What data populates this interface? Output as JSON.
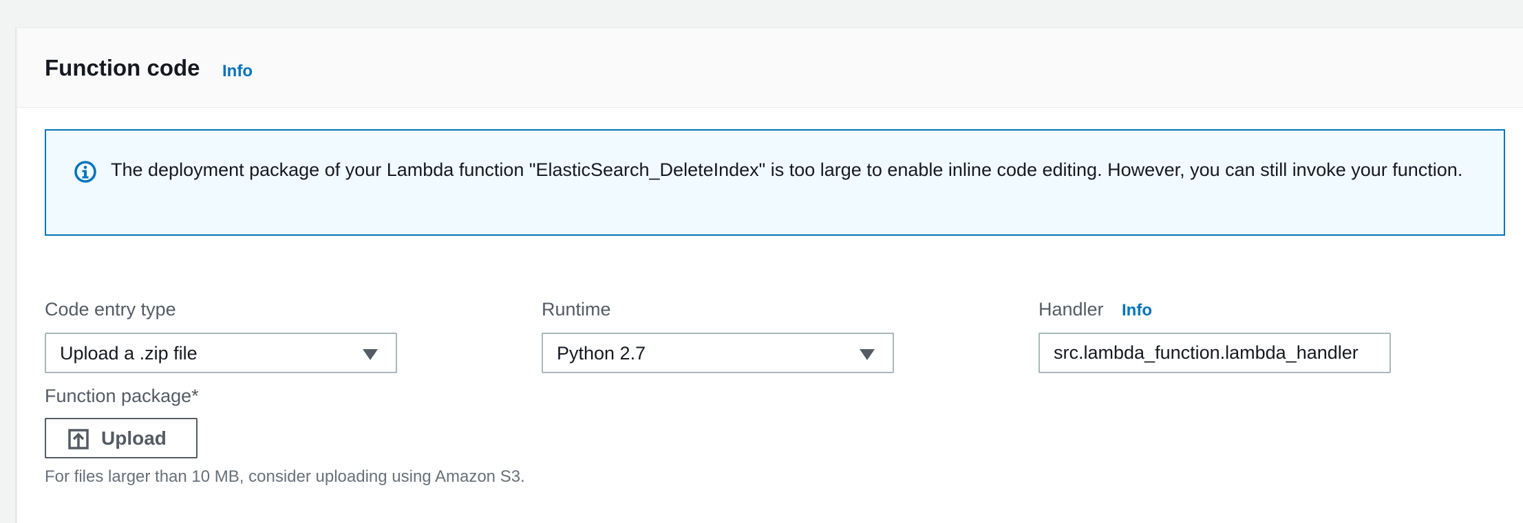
{
  "section": {
    "title": "Function code",
    "info_link": "Info"
  },
  "alert": {
    "icon": "info-circle-icon",
    "message": "The deployment package of your Lambda function \"ElasticSearch_DeleteIndex\" is too large to enable inline code editing. However, you can still invoke your function."
  },
  "fields": {
    "code_entry_type": {
      "label": "Code entry type",
      "value": "Upload a .zip file"
    },
    "runtime": {
      "label": "Runtime",
      "value": "Python 2.7"
    },
    "handler": {
      "label": "Handler",
      "info_link": "Info",
      "value": "src.lambda_function.lambda_handler"
    },
    "function_package": {
      "label": "Function package*",
      "upload_label": "Upload",
      "upload_icon": "upload-icon",
      "hint": "For files larger than 10 MB, consider uploading using Amazon S3."
    }
  },
  "colors": {
    "accent": "#0073bb",
    "alert_background": "#f1faff",
    "page_background": "#f2f3f3"
  }
}
